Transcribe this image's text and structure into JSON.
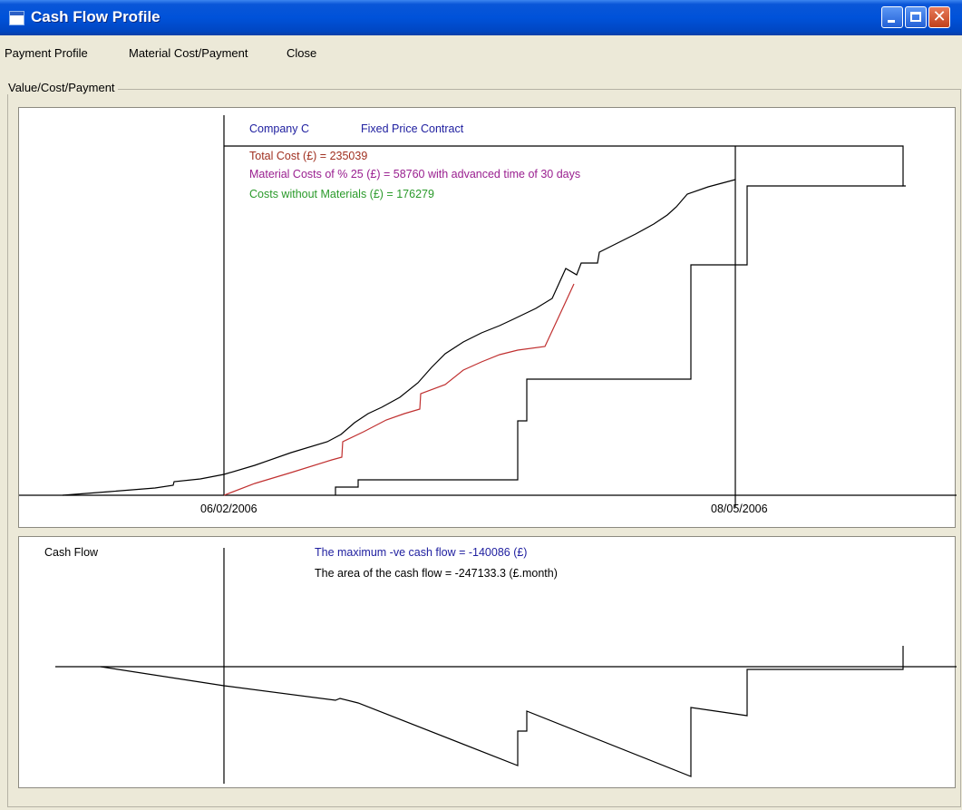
{
  "window": {
    "title": "Cash Flow Profile"
  },
  "menu": {
    "items": [
      "Payment Profile",
      "Material Cost/Payment",
      "Close"
    ]
  },
  "group_label": "Value/Cost/Payment",
  "top_chart": {
    "company": "Company C",
    "contract": "Fixed Price Contract",
    "total_cost": "Total Cost   (£) = 235039",
    "material_costs": "Material Costs of % 25 (£) = 58760 with advanced time of   30  days",
    "costs_without_materials": "Costs without Materials   (£) = 176279",
    "start_date": "06/02/2006",
    "end_date": "08/05/2006"
  },
  "bottom_chart": {
    "title": "Cash Flow",
    "max_negative": "The maximum -ve cash flow =   -140086  (£)",
    "area": "The area of the cash flow    =   -247133.3  (£.month)"
  },
  "colors": {
    "title_blue": "#0052d9",
    "total_cost": "#a03020",
    "material": "#9a2090",
    "without_materials": "#2a9a2a",
    "header": "#2020a0",
    "red_line": "#c03030"
  }
}
